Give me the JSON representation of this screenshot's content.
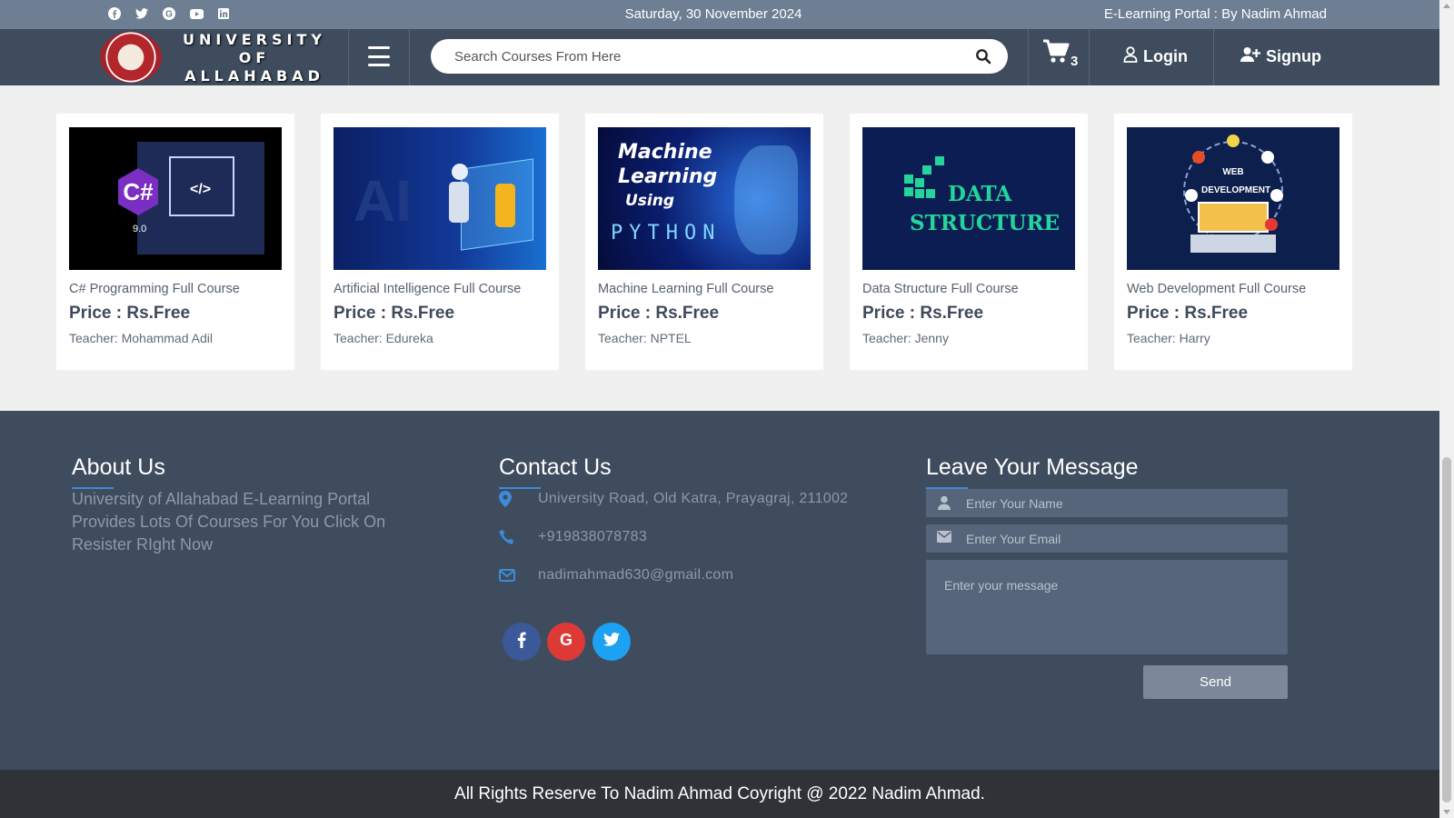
{
  "topbar": {
    "social_icons": [
      "facebook-icon",
      "twitter-icon",
      "google-icon",
      "youtube-icon",
      "linkedin-icon"
    ],
    "date": "Saturday, 30 November 2024",
    "brand": "E-Learning Portal : By Nadim Ahmad"
  },
  "navbar": {
    "university_lines": [
      "UNIVERSITY",
      "OF",
      "ALLAHABAD"
    ],
    "search_placeholder": "Search Courses From Here",
    "cart_count": "3",
    "login_label": "Login",
    "signup_label": "Signup"
  },
  "courses": [
    {
      "title": "C# Programming Full Course",
      "price": "Price : Rs.Free",
      "teacher": "Teacher: Mohammad Adil",
      "thumb_text": "9.0"
    },
    {
      "title": "Artificial Intelligence Full Course",
      "price": "Price : Rs.Free",
      "teacher": "Teacher: Edureka",
      "thumb_text": "AI"
    },
    {
      "title": "Machine Learning Full Course",
      "price": "Price : Rs.Free",
      "teacher": "Teacher: NPTEL",
      "thumb_lines": [
        "Machine",
        "Learning",
        "Using",
        "PYTHON"
      ]
    },
    {
      "title": "Data Structure Full Course",
      "price": "Price : Rs.Free",
      "teacher": "Teacher: Jenny",
      "thumb_lines": [
        "DATA",
        "STRUCTURE"
      ]
    },
    {
      "title": "Web Development Full Course",
      "price": "Price : Rs.Free",
      "teacher": "Teacher: Harry",
      "thumb_lines": [
        "WEB",
        "DEVELOPMENT"
      ]
    }
  ],
  "footer": {
    "about": {
      "heading": "About Us",
      "text": "University of Allahabad E-Learning Portal Provides Lots Of Courses For You Click On Resister RIght Now"
    },
    "contact": {
      "heading": "Contact Us",
      "address": "University Road, Old Katra, Prayagraj, 211002",
      "phone": "+919838078783",
      "email": "nadimahmad630@gmail.com",
      "socials": [
        "facebook-icon",
        "google-icon",
        "twitter-icon"
      ]
    },
    "message": {
      "heading": "Leave Your Message",
      "name_placeholder": "Enter Your Name",
      "email_placeholder": "Enter Your Email",
      "message_placeholder": "Enter your message",
      "send_label": "Send"
    }
  },
  "copyright": "All Rights Reserve To Nadim Ahmad Coyright @ 2022 Nadim Ahmad.",
  "colors": {
    "topbar": "#6e7f93",
    "navbar": "#3e4c5e",
    "footer": "#3e4c5e",
    "accent": "#3d8bd8",
    "facebook": "#3b5998",
    "google": "#dd3a35",
    "twitter": "#1da1f2"
  }
}
